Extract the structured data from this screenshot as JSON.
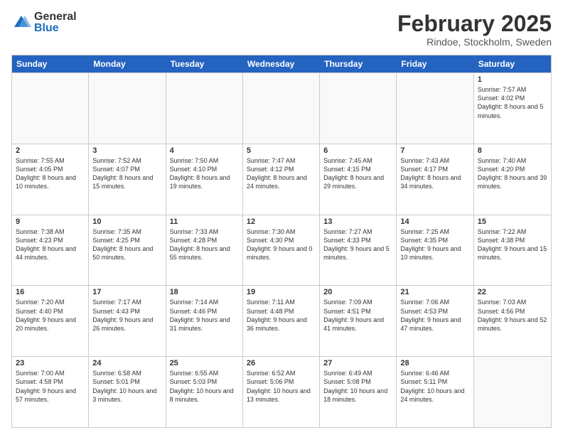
{
  "logo": {
    "general": "General",
    "blue": "Blue"
  },
  "header": {
    "month": "February 2025",
    "location": "Rindoe, Stockholm, Sweden"
  },
  "days": {
    "headers": [
      "Sunday",
      "Monday",
      "Tuesday",
      "Wednesday",
      "Thursday",
      "Friday",
      "Saturday"
    ]
  },
  "weeks": [
    [
      {
        "num": "",
        "info": ""
      },
      {
        "num": "",
        "info": ""
      },
      {
        "num": "",
        "info": ""
      },
      {
        "num": "",
        "info": ""
      },
      {
        "num": "",
        "info": ""
      },
      {
        "num": "",
        "info": ""
      },
      {
        "num": "1",
        "info": "Sunrise: 7:57 AM\nSunset: 4:02 PM\nDaylight: 8 hours and 5 minutes."
      }
    ],
    [
      {
        "num": "2",
        "info": "Sunrise: 7:55 AM\nSunset: 4:05 PM\nDaylight: 8 hours and 10 minutes."
      },
      {
        "num": "3",
        "info": "Sunrise: 7:52 AM\nSunset: 4:07 PM\nDaylight: 8 hours and 15 minutes."
      },
      {
        "num": "4",
        "info": "Sunrise: 7:50 AM\nSunset: 4:10 PM\nDaylight: 8 hours and 19 minutes."
      },
      {
        "num": "5",
        "info": "Sunrise: 7:47 AM\nSunset: 4:12 PM\nDaylight: 8 hours and 24 minutes."
      },
      {
        "num": "6",
        "info": "Sunrise: 7:45 AM\nSunset: 4:15 PM\nDaylight: 8 hours and 29 minutes."
      },
      {
        "num": "7",
        "info": "Sunrise: 7:43 AM\nSunset: 4:17 PM\nDaylight: 8 hours and 34 minutes."
      },
      {
        "num": "8",
        "info": "Sunrise: 7:40 AM\nSunset: 4:20 PM\nDaylight: 8 hours and 39 minutes."
      }
    ],
    [
      {
        "num": "9",
        "info": "Sunrise: 7:38 AM\nSunset: 4:23 PM\nDaylight: 8 hours and 44 minutes."
      },
      {
        "num": "10",
        "info": "Sunrise: 7:35 AM\nSunset: 4:25 PM\nDaylight: 8 hours and 50 minutes."
      },
      {
        "num": "11",
        "info": "Sunrise: 7:33 AM\nSunset: 4:28 PM\nDaylight: 8 hours and 55 minutes."
      },
      {
        "num": "12",
        "info": "Sunrise: 7:30 AM\nSunset: 4:30 PM\nDaylight: 9 hours and 0 minutes."
      },
      {
        "num": "13",
        "info": "Sunrise: 7:27 AM\nSunset: 4:33 PM\nDaylight: 9 hours and 5 minutes."
      },
      {
        "num": "14",
        "info": "Sunrise: 7:25 AM\nSunset: 4:35 PM\nDaylight: 9 hours and 10 minutes."
      },
      {
        "num": "15",
        "info": "Sunrise: 7:22 AM\nSunset: 4:38 PM\nDaylight: 9 hours and 15 minutes."
      }
    ],
    [
      {
        "num": "16",
        "info": "Sunrise: 7:20 AM\nSunset: 4:40 PM\nDaylight: 9 hours and 20 minutes."
      },
      {
        "num": "17",
        "info": "Sunrise: 7:17 AM\nSunset: 4:43 PM\nDaylight: 9 hours and 26 minutes."
      },
      {
        "num": "18",
        "info": "Sunrise: 7:14 AM\nSunset: 4:46 PM\nDaylight: 9 hours and 31 minutes."
      },
      {
        "num": "19",
        "info": "Sunrise: 7:11 AM\nSunset: 4:48 PM\nDaylight: 9 hours and 36 minutes."
      },
      {
        "num": "20",
        "info": "Sunrise: 7:09 AM\nSunset: 4:51 PM\nDaylight: 9 hours and 41 minutes."
      },
      {
        "num": "21",
        "info": "Sunrise: 7:06 AM\nSunset: 4:53 PM\nDaylight: 9 hours and 47 minutes."
      },
      {
        "num": "22",
        "info": "Sunrise: 7:03 AM\nSunset: 4:56 PM\nDaylight: 9 hours and 52 minutes."
      }
    ],
    [
      {
        "num": "23",
        "info": "Sunrise: 7:00 AM\nSunset: 4:58 PM\nDaylight: 9 hours and 57 minutes."
      },
      {
        "num": "24",
        "info": "Sunrise: 6:58 AM\nSunset: 5:01 PM\nDaylight: 10 hours and 3 minutes."
      },
      {
        "num": "25",
        "info": "Sunrise: 6:55 AM\nSunset: 5:03 PM\nDaylight: 10 hours and 8 minutes."
      },
      {
        "num": "26",
        "info": "Sunrise: 6:52 AM\nSunset: 5:06 PM\nDaylight: 10 hours and 13 minutes."
      },
      {
        "num": "27",
        "info": "Sunrise: 6:49 AM\nSunset: 5:08 PM\nDaylight: 10 hours and 18 minutes."
      },
      {
        "num": "28",
        "info": "Sunrise: 6:46 AM\nSunset: 5:11 PM\nDaylight: 10 hours and 24 minutes."
      },
      {
        "num": "",
        "info": ""
      }
    ]
  ]
}
